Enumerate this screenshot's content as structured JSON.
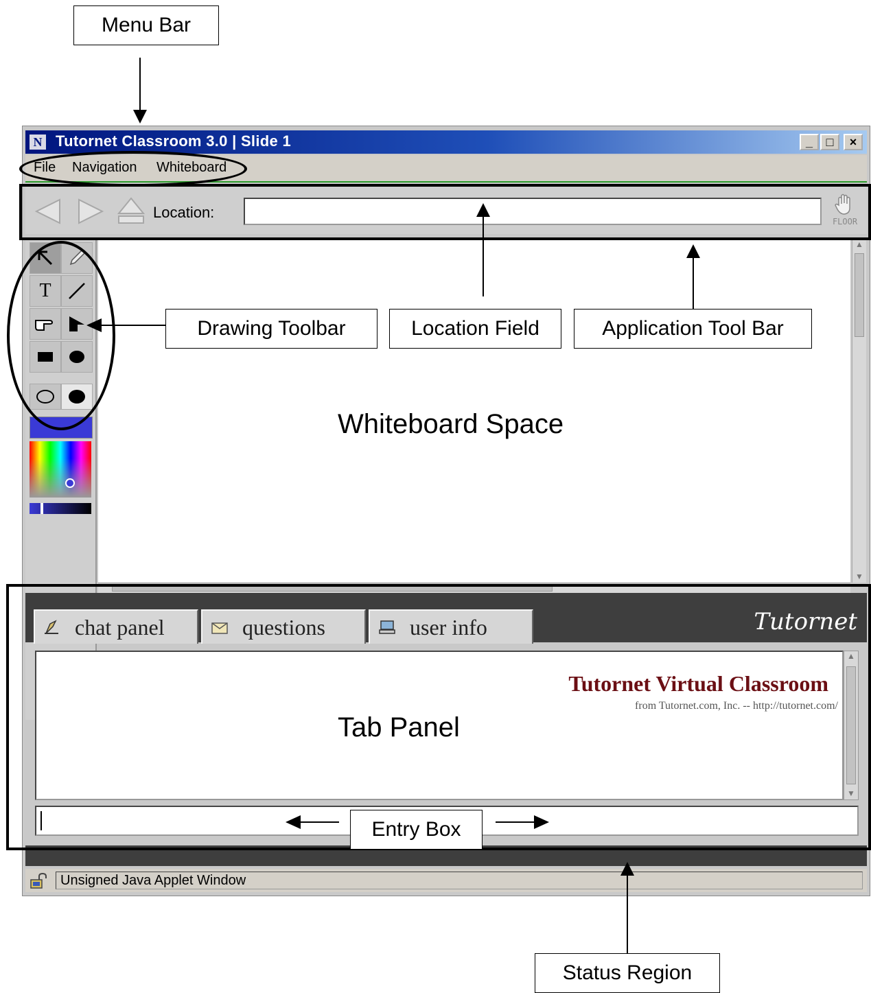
{
  "callouts": {
    "menu_bar": "Menu Bar",
    "drawing_toolbar": "Drawing Toolbar",
    "location_field": "Location Field",
    "application_tool_bar": "Application Tool Bar",
    "entry_box": "Entry Box",
    "status_region": "Status Region"
  },
  "regions": {
    "whiteboard_space": "Whiteboard Space",
    "tab_panel": "Tab Panel"
  },
  "window": {
    "title": "Tutornet Classroom 3.0 | Slide 1",
    "title_icon": "N",
    "controls": {
      "minimize": "_",
      "maximize": "□",
      "close": "×"
    }
  },
  "menu": {
    "items": [
      "File",
      "Navigation",
      "Whiteboard"
    ]
  },
  "toolbar": {
    "location_label": "Location:",
    "location_value": "",
    "floor_label": "FLOOR"
  },
  "draw_tools": {
    "text_tool": "T"
  },
  "tabs": [
    {
      "label": "chat panel",
      "icon": "quill-icon"
    },
    {
      "label": "questions",
      "icon": "envelope-icon"
    },
    {
      "label": "user info",
      "icon": "computer-icon"
    }
  ],
  "brand": {
    "logo": "Tutornet",
    "title": "Tutornet Virtual Classroom",
    "subtitle": "from Tutornet.com, Inc. -- http://tutornet.com/"
  },
  "status": {
    "text": "Unsigned Java Applet Window"
  },
  "colors": {
    "title_bar": "#00157e",
    "selected_color": "#3a3ad6",
    "brand_text": "#6b0f14",
    "tab_strip": "#3e3e3e"
  }
}
